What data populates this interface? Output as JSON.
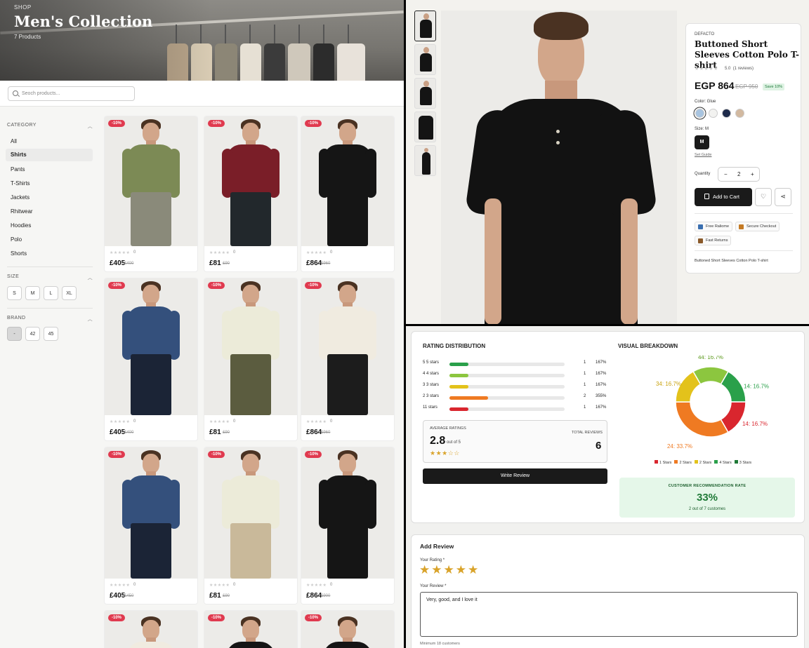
{
  "hero": {
    "kicker": "SHOP",
    "title": "Men's Collection",
    "count": "7 Products"
  },
  "search": {
    "placeholder": "Seoch products..."
  },
  "sidebar": {
    "category_title": "CATEGORY",
    "categories": [
      "All",
      "Shirts",
      "Pants",
      "T-Shirts",
      "Jackets",
      "Rhitwear",
      "Hoodies",
      "Polo",
      "Shorts"
    ],
    "active_category": "Shirts",
    "size_title": "SIZE",
    "sizes": [
      "S",
      "M",
      "L",
      "XL"
    ],
    "brand_title": "BRAND",
    "brands": [
      "-",
      "42",
      "45"
    ]
  },
  "products": [
    {
      "badge": "-10%",
      "rating": "0",
      "price": "£405",
      "old": "£400",
      "shirt": "#7c8a55",
      "pants": "#8a8a7a"
    },
    {
      "badge": "-10%",
      "rating": "0",
      "price": "£81",
      "old": "£90",
      "shirt": "#7a1e28",
      "pants": "#22282c"
    },
    {
      "badge": "-10%",
      "rating": "0",
      "price": "£864",
      "old": "£960",
      "shirt": "#151515",
      "pants": "#151515"
    },
    {
      "badge": "-10%",
      "rating": "0",
      "price": "£405",
      "old": "£400",
      "shirt": "#34507c",
      "pants": "#1b2436"
    },
    {
      "badge": "-10%",
      "rating": "0",
      "price": "£81",
      "old": "£90",
      "shirt": "#ecebd9",
      "pants": "#5b5c3f"
    },
    {
      "badge": "-10%",
      "rating": "0",
      "price": "£864",
      "old": "£960",
      "shirt": "#f0ebe0",
      "pants": "#1c1c1c"
    },
    {
      "badge": "-10%",
      "rating": "0",
      "price": "£405",
      "old": "£450",
      "shirt": "#34507c",
      "pants": "#1b2436"
    },
    {
      "badge": "-10%",
      "rating": "0",
      "price": "£81",
      "old": "£90",
      "shirt": "#ecebd9",
      "pants": "#c9b99a"
    },
    {
      "badge": "-10%",
      "rating": "0",
      "price": "£864",
      "old": "£900",
      "shirt": "#151515",
      "pants": "#151515"
    },
    {
      "badge": "-10%",
      "rating": "",
      "price": "",
      "old": "",
      "shirt": "#f0ebe0",
      "pants": "#f0ebe0"
    },
    {
      "badge": "-10%",
      "rating": "",
      "price": "",
      "old": "",
      "shirt": "#151515",
      "pants": "#151515"
    },
    {
      "badge": "-10%",
      "rating": "",
      "price": "",
      "old": "",
      "shirt": "#151515",
      "pants": "#151515"
    }
  ],
  "pdp": {
    "brand": "DEFACTO",
    "title": "Buttoned Short Sleeves Cotton Polo T-shirt",
    "rating_text": "5.0",
    "reviews_text": "(1 reviews)",
    "price": "EGP 864",
    "old_price": "EGP 950",
    "save": "Save 10%",
    "color_label": "Color: Glue",
    "colors": [
      "#a8c4e0",
      "#f2f2f0",
      "#1d2a4a",
      "#d2b9a0"
    ],
    "size_label": "Size: M",
    "size_selected": "M",
    "size_guide": "Set Guide",
    "qty_label": "Quantity",
    "qty_minus": "−",
    "qty_value": "2",
    "qty_plus": "+",
    "add_to_cart": "Add to Cart",
    "wish_icon": "♡",
    "share_icon": "⋖",
    "features": [
      "Free Raliome",
      "Secure Checkout",
      "Fast Returns"
    ],
    "description": "Buttoned Short Sleeves Cotton Polo T-shirt"
  },
  "reviews": {
    "dist_title": "RATING DISTRIBUTION",
    "rows": [
      {
        "label": "5 5 stars",
        "fill": 0.167,
        "color": "#2aa04a",
        "count": "1",
        "pct": "167%"
      },
      {
        "label": "4 4 stars",
        "fill": 0.167,
        "color": "#8cc63f",
        "count": "1",
        "pct": "167%"
      },
      {
        "label": "3 3 stars",
        "fill": 0.167,
        "color": "#e3c21b",
        "count": "1",
        "pct": "167%"
      },
      {
        "label": "2 3 stars",
        "fill": 0.335,
        "color": "#ef7a22",
        "count": "2",
        "pct": "355%"
      },
      {
        "label": "11 stars",
        "fill": 0.167,
        "color": "#d9262e",
        "count": "1",
        "pct": "167%"
      }
    ],
    "avg_label": "AVERAGE RATINGS",
    "avg_value": "2.8",
    "avg_of": "out of 5",
    "avg_stars": "★★★☆☆",
    "total_label": "TOTAL REVIEWS",
    "total_value": "6",
    "write_review": "Write Review",
    "visual_title": "VISUAL BREAKDOWN",
    "rec_title": "CUSTOMER RECOMMENDATION RATE",
    "rec_value": "33%",
    "rec_sub": "2 out of 7 customes"
  },
  "chart_data": {
    "type": "pie",
    "slices": [
      {
        "label": "44: 16.7%",
        "value": 16.7,
        "color": "#8cc63f"
      },
      {
        "label": "14: 16.7%",
        "value": 16.7,
        "color": "#2aa04a"
      },
      {
        "label": "14: 16.7%",
        "value": 16.7,
        "color": "#d9262e"
      },
      {
        "label": "24: 33.7%",
        "value": 33.3,
        "color": "#ef7a22"
      },
      {
        "label": "34: 16.7%",
        "value": 16.7,
        "color": "#e3c21b"
      }
    ],
    "legend": [
      {
        "name": "1 Stars",
        "color": "#d9262e"
      },
      {
        "name": "2 Stars",
        "color": "#ef7a22"
      },
      {
        "name": "2 Stars",
        "color": "#e3c21b"
      },
      {
        "name": "4 Stars",
        "color": "#2aa04a"
      },
      {
        "name": "3 Stars",
        "color": "#1f7a37"
      }
    ]
  },
  "add_review": {
    "title": "Add Review",
    "rating_label": "Your Rating *",
    "stars": "★★★★★",
    "text_label": "Your Review *",
    "text_value": "Very, good, and I love it",
    "hint": "Minimum 18 customers"
  }
}
